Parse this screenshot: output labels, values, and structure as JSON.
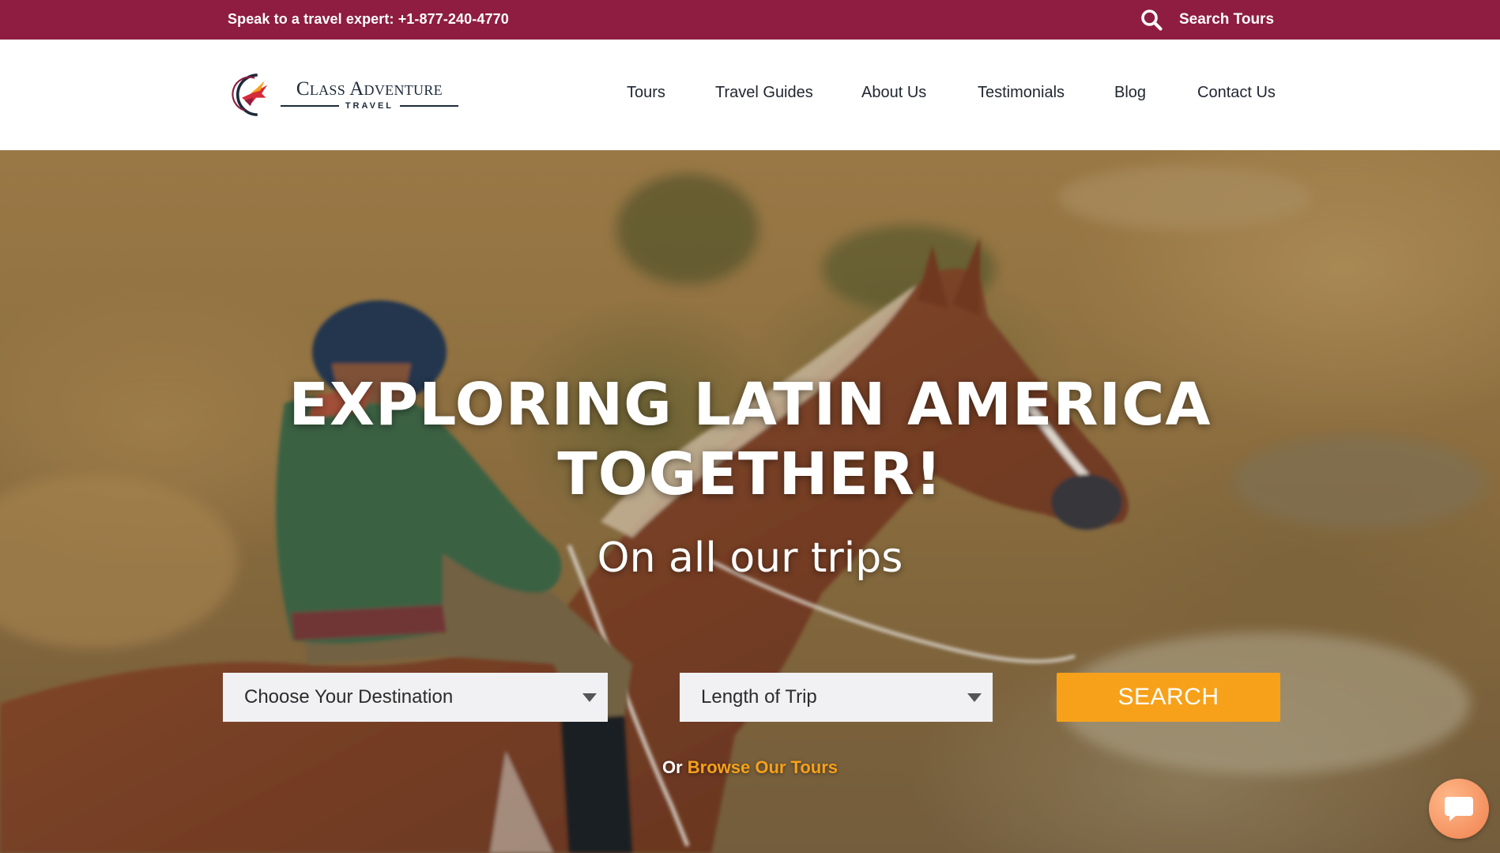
{
  "topbar": {
    "phone_text": "Speak to a travel expert: +1-877-240-4770",
    "search_label": "Search Tours",
    "search_icon": "search-icon"
  },
  "header": {
    "logo": {
      "brand": "Class Adventure",
      "sub": "TRAVEL",
      "mark_icon": "hummingbird-logo-icon"
    },
    "nav": [
      {
        "label": "Tours"
      },
      {
        "label": "Travel Guides"
      },
      {
        "label": "About Us"
      },
      {
        "label": "Testimonials"
      },
      {
        "label": "Blog"
      },
      {
        "label": "Contact Us"
      }
    ]
  },
  "hero": {
    "title_line1": "EXPLORING LATIN AMERICA",
    "title_line2": "TOGETHER!",
    "subtitle": "On all our trips",
    "destination_select": "Choose Your Destination",
    "length_select": "Length of Trip",
    "search_button": "SEARCH",
    "browse_prefix": "Or",
    "browse_link": "Browse Our Tours"
  },
  "chat": {
    "icon": "chat-bubble-icon"
  },
  "colors": {
    "brand_primary": "#8e1d41",
    "accent_orange": "#f7a11a",
    "nav_text": "#1f2630",
    "chat_orange": "#f0804e"
  }
}
